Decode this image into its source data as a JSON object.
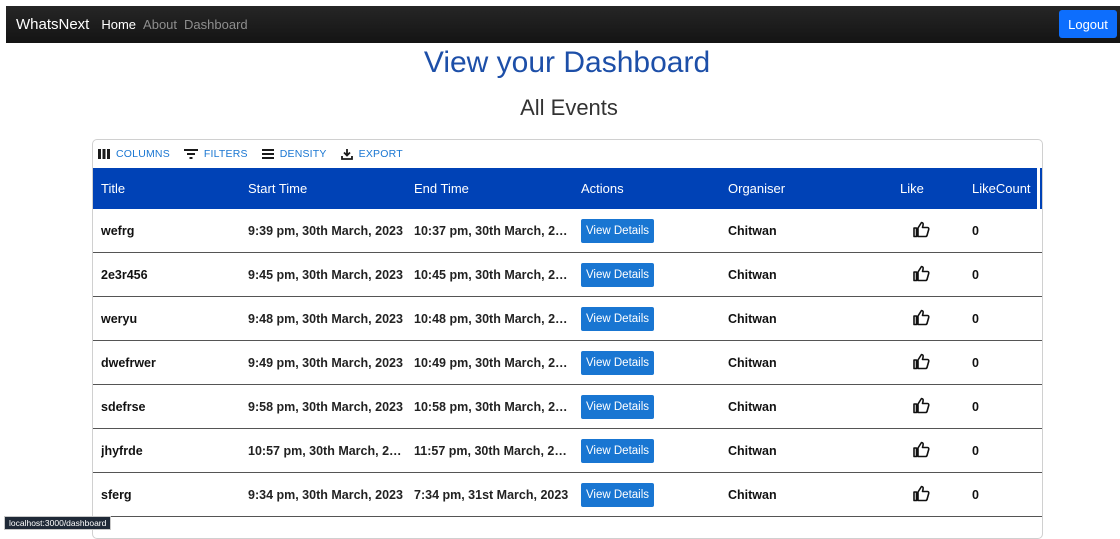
{
  "navbar": {
    "brand": "WhatsNext",
    "links": [
      {
        "label": "Home"
      },
      {
        "label": "About"
      },
      {
        "label": "Dashboard"
      }
    ],
    "logout_label": "Logout"
  },
  "page": {
    "title": "View your Dashboard",
    "subtitle": "All Events"
  },
  "toolbar": {
    "columns_label": "Columns",
    "filters_label": "Filters",
    "density_label": "Density",
    "export_label": "Export"
  },
  "table": {
    "columns": [
      "Title",
      "Start Time",
      "End Time",
      "Actions",
      "Organiser",
      "Like",
      "LikeCount"
    ],
    "action_label": "View Details",
    "rows": [
      {
        "title": "wefrg",
        "start": "9:39 pm, 30th March, 2023",
        "end": "10:37 pm, 30th March, 20…",
        "organiser": "Chitwan",
        "like_count": "0"
      },
      {
        "title": "2e3r456",
        "start": "9:45 pm, 30th March, 2023",
        "end": "10:45 pm, 30th March, 20…",
        "organiser": "Chitwan",
        "like_count": "0"
      },
      {
        "title": "weryu",
        "start": "9:48 pm, 30th March, 2023",
        "end": "10:48 pm, 30th March, 20…",
        "organiser": "Chitwan",
        "like_count": "0"
      },
      {
        "title": "dwefrwer",
        "start": "9:49 pm, 30th March, 2023",
        "end": "10:49 pm, 30th March, 20…",
        "organiser": "Chitwan",
        "like_count": "0"
      },
      {
        "title": "sdefrse",
        "start": "9:58 pm, 30th March, 2023",
        "end": "10:58 pm, 30th March, 20…",
        "organiser": "Chitwan",
        "like_count": "0"
      },
      {
        "title": "jhyfrde",
        "start": "10:57 pm, 30th March, 20…",
        "end": "11:57 pm, 30th March, 20…",
        "organiser": "Chitwan",
        "like_count": "0"
      },
      {
        "title": "sferg",
        "start": "9:34 pm, 30th March, 2023",
        "end": "7:34 pm, 31st March, 2023",
        "organiser": "Chitwan",
        "like_count": "0"
      }
    ]
  },
  "status_bar": {
    "url": "localhost:3000/dashboard"
  },
  "colors": {
    "navbar": "#1a1a1a",
    "title": "#1d4fa8",
    "header": "#0042b6",
    "button": "#1976d2",
    "logout": "#0d6efd"
  },
  "icons": {
    "columns": "columns-icon",
    "filters": "filter-icon",
    "density": "density-icon",
    "export": "export-icon",
    "like": "thumbs-up-icon"
  }
}
